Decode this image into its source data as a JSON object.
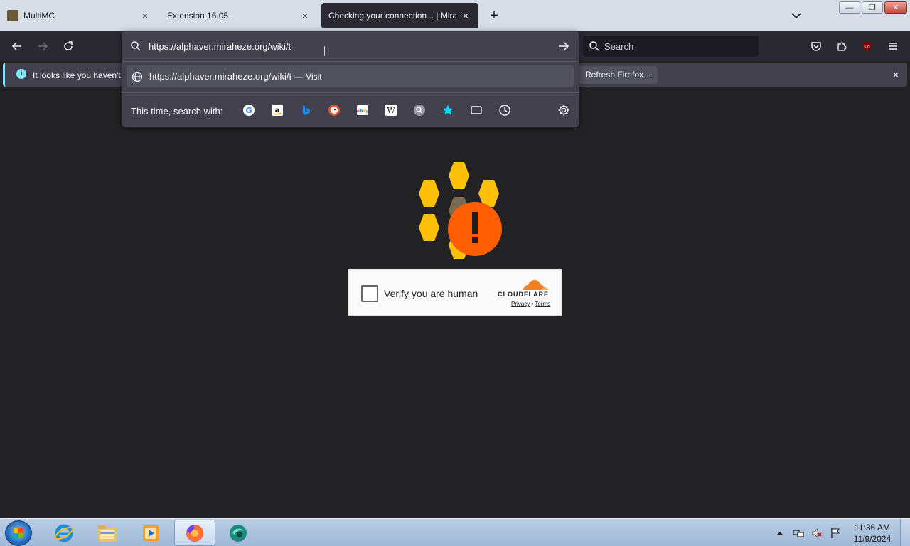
{
  "tabs": [
    {
      "label": "MultiMC",
      "close": "×"
    },
    {
      "label": "Extension 16.05",
      "close": "×"
    },
    {
      "label": "Checking your connection... | Mirah",
      "close": "×"
    }
  ],
  "new_tab": "+",
  "window_controls": {
    "minimize": "—",
    "restore": "❐",
    "close": "✕"
  },
  "search": {
    "placeholder": "Search"
  },
  "url_bar": {
    "value": "https://alphaver.miraheze.org/wiki/t"
  },
  "suggestion": {
    "url": "https://alphaver.miraheze.org/wiki/t",
    "separator": "—",
    "action": "Visit"
  },
  "one_off": {
    "label": "This time, search with:",
    "engines": [
      "google-icon",
      "amazon-icon",
      "bing-icon",
      "duckduckgo-icon",
      "ebay-icon",
      "wikipedia-icon",
      "search-engine-icon",
      "bookmarks-icon",
      "tabs-icon",
      "history-icon"
    ]
  },
  "notification": {
    "text": "It looks like you haven't",
    "button": "Refresh Firefox...",
    "close": "×",
    "icon": "i"
  },
  "challenge": {
    "checkbox_label": "Verify you are human",
    "brand": "CLOUDFLARE",
    "privacy": "Privacy",
    "dot": "•",
    "terms": "Terms",
    "colors": {
      "hex": "#ffc107",
      "alert": "#ff5e00",
      "center": "#7a6a4f"
    }
  },
  "taskbar": {
    "clock_time": "11:36 AM",
    "clock_date": "11/9/2024",
    "apps": [
      "internet-explorer-icon",
      "file-explorer-icon",
      "media-player-icon",
      "firefox-icon",
      "app-icon"
    ]
  },
  "colors": {
    "chrome": "#2b2a33",
    "tabstrip": "#d6dde7",
    "accent": "#80ebff"
  }
}
